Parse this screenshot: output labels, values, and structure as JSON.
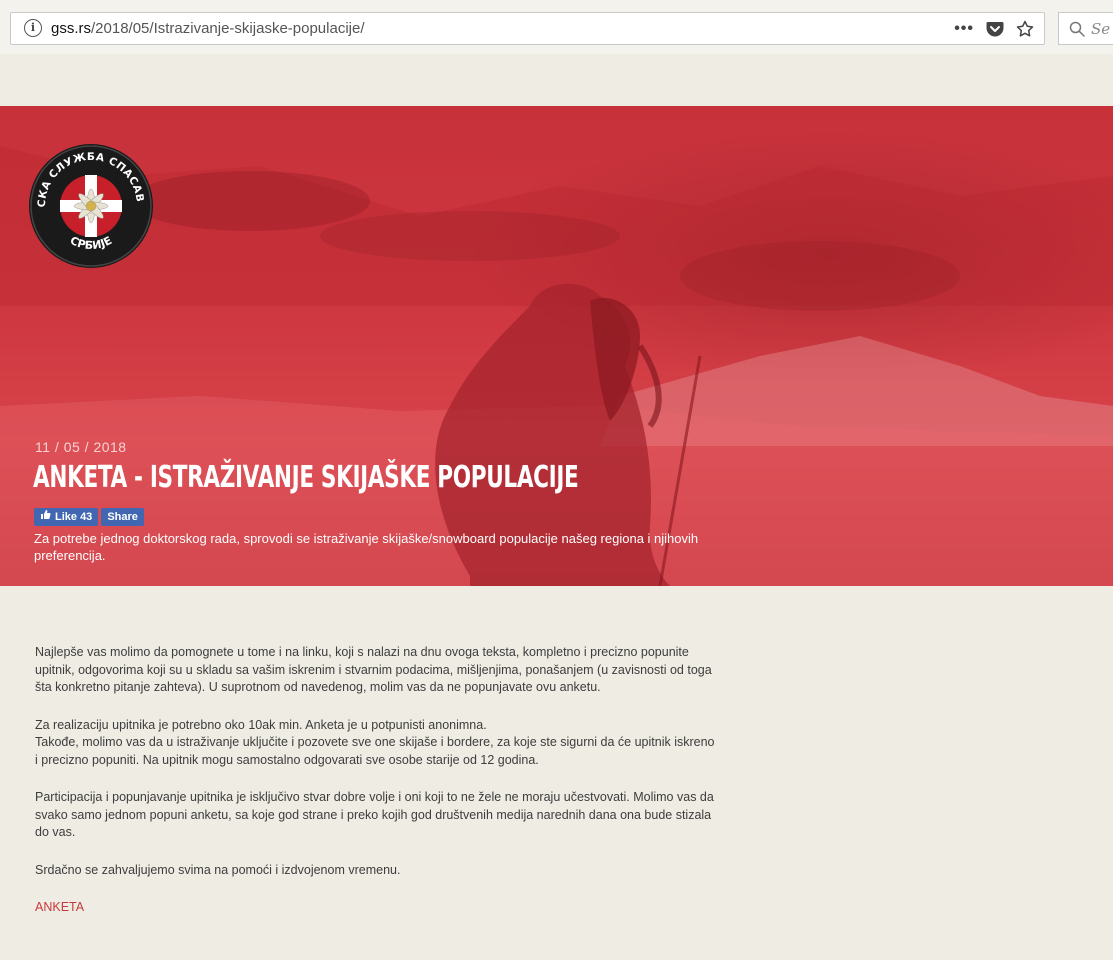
{
  "browser": {
    "url_domain": "gss.rs",
    "url_path": "/2018/05/Istrazivanje-skijaske-populacije/",
    "more_label": "•••",
    "search_placeholder": "Se"
  },
  "logo": {
    "text_top": "ГОРСКА СЛУЖБА СПАСАВАЊА",
    "text_bottom": "СРБИЈЕ"
  },
  "hero": {
    "date": "11 / 05 / 2018",
    "title": "ANKETA - ISTRAŽIVANJE SKIJAŠKE POPULACIJE",
    "like_label": "Like 43",
    "share_label": "Share",
    "description": "Za potrebe jednog doktorskog rada, sprovodi se istraživanje skijaške/snowboard populacije našeg regiona i njihovih preferencija."
  },
  "article": {
    "p1": "Najlepše vas molimo da pomognete u tome i na linku, koji s nalazi na dnu ovoga teksta, kompletno i precizno popunite upitnik, odgovorima koji su u skladu sa vašim iskrenim i stvarnim podacima, mišljenjima, ponašanjem (u zavisnosti od toga šta konkretno pitanje zahteva). U suprotnom od navedenog, molim vas da ne popunjavate ovu anketu.",
    "p2_line1": "Za realizaciju upitnika je potrebno oko 10ak min. Anketa je u potpunisti anonimna.",
    "p2_line2": "Takođe, molimo vas da u istraživanje uključite i pozovete sve one skijaše i bordere, za koje ste sigurni da će upitnik iskreno i precizno popuniti. Na upitnik mogu samostalno odgovarati sve osobe starije od 12 godina.",
    "p3": "Participacija i popunjavanje upitnika je isključivo stvar dobre volje i oni koji to ne žele ne moraju učestvovati. Molimo vas da svako samo jednom popuni anketu, sa koje god strane i preko kojih god društvenih medija narednih dana ona bude stizala do vas.",
    "p4": "Srdačno se zahvaljujemo svima na pomoći i izdvojenom vremenu.",
    "link_label": "ANKETA"
  },
  "colors": {
    "accent_red": "#c8393c",
    "facebook_blue": "#4267b2",
    "page_bg": "#efece4"
  }
}
